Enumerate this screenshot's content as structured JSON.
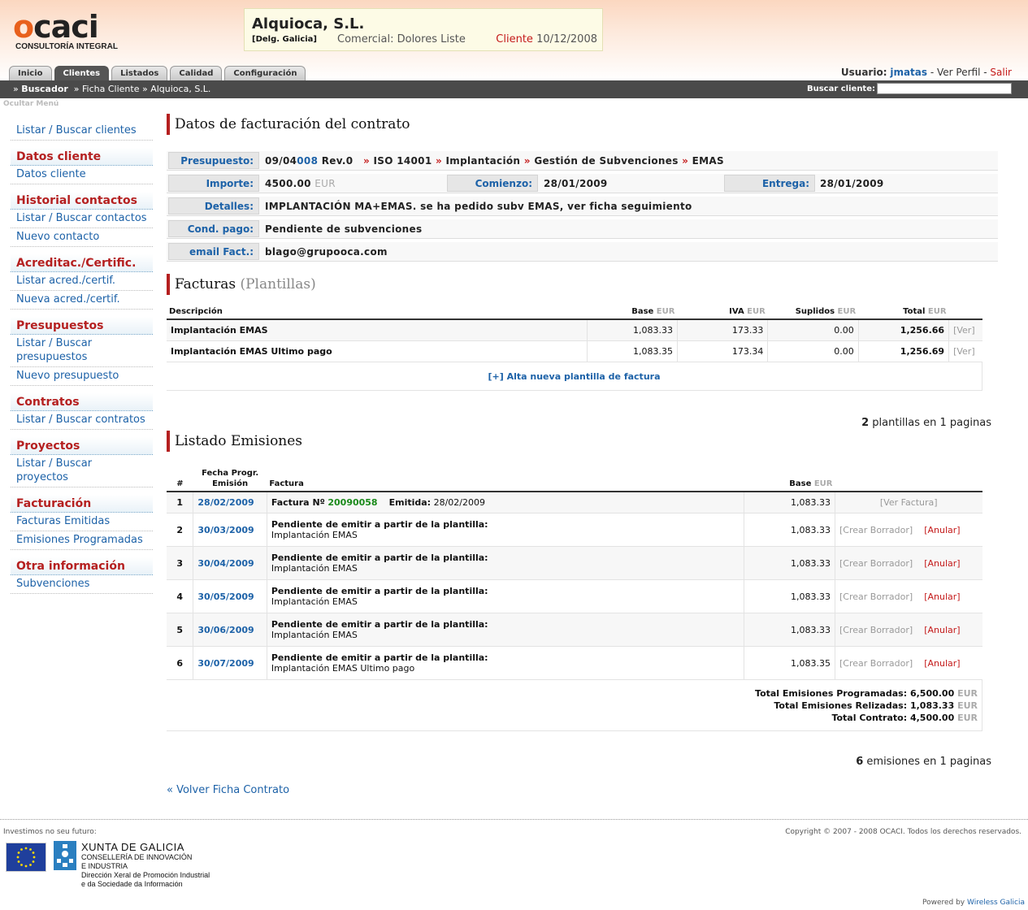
{
  "header": {
    "logo_text": "ocaci",
    "logo_sub": "CONSULTORÍA INTEGRAL",
    "client_name": "Alquioca, S.L.",
    "delg": "[Delg. Galicia]",
    "comercial": "Comercial: Dolores Liste",
    "cliente_label": "Cliente",
    "cliente_date": "10/12/2008",
    "tabs": [
      "Inicio",
      "Clientes",
      "Listados",
      "Calidad",
      "Configuración"
    ],
    "user_label": "Usuario:",
    "user_name": "jmatas",
    "ver_perfil": "Ver Perfil",
    "salir": "Salir",
    "sep1": " - ",
    "sep2": " - "
  },
  "breadcrumb": {
    "raquo": "»",
    "item1": "Buscador",
    "item2": "» Ficha Cliente",
    "item3": "» Alquioca, S.L.",
    "search_label": "Buscar cliente:",
    "hide_menu": "Ocultar Menú"
  },
  "sidebar": {
    "listar_clientes": "Listar / Buscar clientes",
    "h_datos": "Datos cliente",
    "datos_cliente": "Datos cliente",
    "h_historial": "Historial contactos",
    "listar_contactos": "Listar / Buscar contactos",
    "nuevo_contacto": "Nuevo contacto",
    "h_acred": "Acreditac./Certific.",
    "listar_acred": "Listar acred./certif.",
    "nueva_acred": "Nueva acred./certif.",
    "h_presupuestos": "Presupuestos",
    "listar_presupuestos": "Listar / Buscar presupuestos",
    "nuevo_presupuesto": "Nuevo presupuesto",
    "h_contratos": "Contratos",
    "listar_contratos": "Listar / Buscar contratos",
    "h_proyectos": "Proyectos",
    "listar_proyectos": "Listar / Buscar proyectos",
    "h_facturacion": "Facturación",
    "facturas_emitidas": "Facturas Emitidas",
    "emisiones_programadas": "Emisiones Programadas",
    "h_otra": "Otra información",
    "subvenciones": "Subvenciones"
  },
  "datos": {
    "title": "Datos de facturación del contrato",
    "presupuesto_label": "Presupuesto:",
    "presupuesto_a": "09/04",
    "presupuesto_b": "008",
    "presupuesto_c": "Rev.0",
    "path_sep": "»",
    "path1": "ISO 14001",
    "path2": "Implantación",
    "path3": "Gestión de Subvenciones",
    "path4": "EMAS",
    "importe_label": "Importe:",
    "importe_value": "4500.00",
    "eur": "EUR",
    "comienzo_label": "Comienzo:",
    "comienzo_value": "28/01/2009",
    "entrega_label": "Entrega:",
    "entrega_value": "28/01/2009",
    "detalles_label": "Detalles:",
    "detalles_value": "IMPLANTACIÓN MA+EMAS. se ha pedido subv EMAS, ver ficha seguimiento",
    "cond_label": "Cond. pago:",
    "cond_value": "Pendiente de subvenciones",
    "email_label": "email Fact.:",
    "email_value": "blago@grupooca.com"
  },
  "facturas": {
    "title": "Facturas",
    "title_muted": "(Plantillas)",
    "headers": {
      "desc": "Descripción",
      "base": "Base",
      "iva": "IVA",
      "suplidos": "Suplidos",
      "total": "Total",
      "eur": "EUR"
    },
    "rows": [
      {
        "desc": "Implantación EMAS",
        "base": "1,083.33",
        "iva": "173.33",
        "suplidos": "0.00",
        "total": "1,256.66",
        "action": "[Ver]"
      },
      {
        "desc": "Implantación EMAS Ultimo pago",
        "base": "1,083.35",
        "iva": "173.34",
        "suplidos": "0.00",
        "total": "1,256.69",
        "action": "[Ver]"
      }
    ],
    "alta": "[+] Alta nueva plantilla de factura",
    "pag_count": "2",
    "pag_text": "plantillas en 1 paginas"
  },
  "emisiones": {
    "title": "Listado Emisiones",
    "headers": {
      "num": "#",
      "fecha1": "Fecha Progr.",
      "fecha2": "Emisión",
      "factura": "Factura",
      "base": "Base",
      "eur": "EUR"
    },
    "row1": {
      "num": "1",
      "fecha": "28/02/2009",
      "factura_label": "Factura Nº",
      "factura_num": "20090058",
      "emitida_label": "Emitida:",
      "emitida_date": "28/02/2009",
      "base": "1,083.33",
      "action": "[Ver Factura]"
    },
    "pending_label": "Pendiente de emitir a partir de la plantilla:",
    "crear": "[Crear Borrador]",
    "anular": "[Anular]",
    "rows": [
      {
        "num": "2",
        "fecha": "30/03/2009",
        "plantilla": "Implantación EMAS",
        "base": "1,083.33"
      },
      {
        "num": "3",
        "fecha": "30/04/2009",
        "plantilla": "Implantación EMAS",
        "base": "1,083.33"
      },
      {
        "num": "4",
        "fecha": "30/05/2009",
        "plantilla": "Implantación EMAS",
        "base": "1,083.33"
      },
      {
        "num": "5",
        "fecha": "30/06/2009",
        "plantilla": "Implantación EMAS",
        "base": "1,083.33"
      },
      {
        "num": "6",
        "fecha": "30/07/2009",
        "plantilla": "Implantación EMAS Ultimo pago",
        "base": "1,083.35"
      }
    ],
    "tot_prog_label": "Total Emisiones Programadas:",
    "tot_prog": "6,500.00",
    "tot_real_label": "Total Emisiones Relizadas:",
    "tot_real": "1,083.33",
    "tot_contrato_label": "Total Contrato:",
    "tot_contrato": "4,500.00",
    "pag_count": "6",
    "pag_text": "emisiones en 1 paginas",
    "volver": "« Volver Ficha Contrato"
  },
  "footer": {
    "invest": "Investimos no seu futuro:",
    "xunta": "XUNTA DE GALICIA",
    "consel1": "CONSELLERÍA DE INNOVACIÓN",
    "consel2": "E INDUSTRIA",
    "dir1": "Dirección Xeral de Promoción Industrial",
    "dir2": "e da Sociedade da Información",
    "copyright": "Copyright © 2007 - 2008 OCACI. Todos los derechos reservados.",
    "powered": "Powered by",
    "powered_by": "Wireless Galicia"
  }
}
